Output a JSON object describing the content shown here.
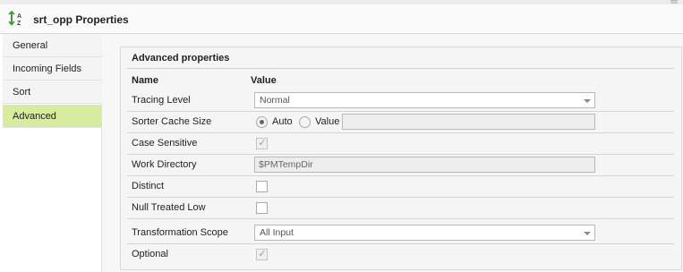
{
  "window": {
    "title": "srt_opp Properties",
    "icon": "sort-az-icon",
    "accent_color": "#3d9a2f",
    "top_right_glyph": "tttt"
  },
  "sidebar": {
    "items": [
      {
        "label": "General",
        "active": false
      },
      {
        "label": "Incoming Fields",
        "active": false
      },
      {
        "label": "Sort",
        "active": false
      },
      {
        "label": "Advanced",
        "active": true
      }
    ],
    "active_color": "#d7ec9e"
  },
  "panel": {
    "title": "Advanced properties",
    "headers": {
      "name": "Name",
      "value": "Value"
    },
    "rows": {
      "tracing_level": {
        "label": "Tracing Level",
        "value": "Normal"
      },
      "sorter_cache_size": {
        "label": "Sorter Cache Size",
        "option_auto": "Auto",
        "option_value": "Value",
        "selected": "Auto",
        "value": ""
      },
      "case_sensitive": {
        "label": "Case Sensitive",
        "checked": true,
        "disabled": true
      },
      "work_directory": {
        "label": "Work Directory",
        "value": "$PMTempDir"
      },
      "distinct": {
        "label": "Distinct",
        "checked": false
      },
      "null_treated_low": {
        "label": "Null Treated Low",
        "checked": false
      },
      "transformation_scope": {
        "label": "Transformation Scope",
        "value": "All Input"
      },
      "optional": {
        "label": "Optional",
        "checked": true,
        "disabled": true
      }
    }
  }
}
